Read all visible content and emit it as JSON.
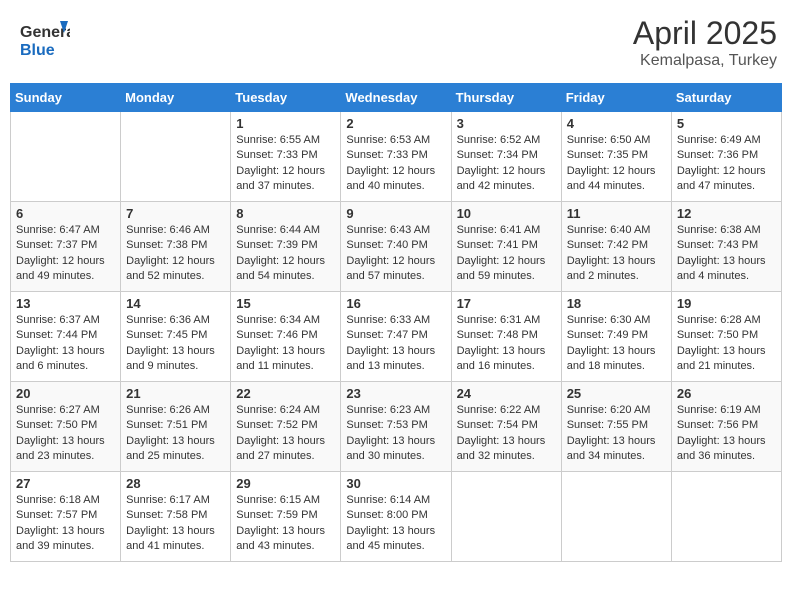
{
  "header": {
    "logo_general": "General",
    "logo_blue": "Blue",
    "title": "April 2025",
    "subtitle": "Kemalpasa, Turkey"
  },
  "days_of_week": [
    "Sunday",
    "Monday",
    "Tuesday",
    "Wednesday",
    "Thursday",
    "Friday",
    "Saturday"
  ],
  "weeks": [
    [
      {
        "day": "",
        "content": ""
      },
      {
        "day": "",
        "content": ""
      },
      {
        "day": "1",
        "content": "Sunrise: 6:55 AM\nSunset: 7:33 PM\nDaylight: 12 hours and 37 minutes."
      },
      {
        "day": "2",
        "content": "Sunrise: 6:53 AM\nSunset: 7:33 PM\nDaylight: 12 hours and 40 minutes."
      },
      {
        "day": "3",
        "content": "Sunrise: 6:52 AM\nSunset: 7:34 PM\nDaylight: 12 hours and 42 minutes."
      },
      {
        "day": "4",
        "content": "Sunrise: 6:50 AM\nSunset: 7:35 PM\nDaylight: 12 hours and 44 minutes."
      },
      {
        "day": "5",
        "content": "Sunrise: 6:49 AM\nSunset: 7:36 PM\nDaylight: 12 hours and 47 minutes."
      }
    ],
    [
      {
        "day": "6",
        "content": "Sunrise: 6:47 AM\nSunset: 7:37 PM\nDaylight: 12 hours and 49 minutes."
      },
      {
        "day": "7",
        "content": "Sunrise: 6:46 AM\nSunset: 7:38 PM\nDaylight: 12 hours and 52 minutes."
      },
      {
        "day": "8",
        "content": "Sunrise: 6:44 AM\nSunset: 7:39 PM\nDaylight: 12 hours and 54 minutes."
      },
      {
        "day": "9",
        "content": "Sunrise: 6:43 AM\nSunset: 7:40 PM\nDaylight: 12 hours and 57 minutes."
      },
      {
        "day": "10",
        "content": "Sunrise: 6:41 AM\nSunset: 7:41 PM\nDaylight: 12 hours and 59 minutes."
      },
      {
        "day": "11",
        "content": "Sunrise: 6:40 AM\nSunset: 7:42 PM\nDaylight: 13 hours and 2 minutes."
      },
      {
        "day": "12",
        "content": "Sunrise: 6:38 AM\nSunset: 7:43 PM\nDaylight: 13 hours and 4 minutes."
      }
    ],
    [
      {
        "day": "13",
        "content": "Sunrise: 6:37 AM\nSunset: 7:44 PM\nDaylight: 13 hours and 6 minutes."
      },
      {
        "day": "14",
        "content": "Sunrise: 6:36 AM\nSunset: 7:45 PM\nDaylight: 13 hours and 9 minutes."
      },
      {
        "day": "15",
        "content": "Sunrise: 6:34 AM\nSunset: 7:46 PM\nDaylight: 13 hours and 11 minutes."
      },
      {
        "day": "16",
        "content": "Sunrise: 6:33 AM\nSunset: 7:47 PM\nDaylight: 13 hours and 13 minutes."
      },
      {
        "day": "17",
        "content": "Sunrise: 6:31 AM\nSunset: 7:48 PM\nDaylight: 13 hours and 16 minutes."
      },
      {
        "day": "18",
        "content": "Sunrise: 6:30 AM\nSunset: 7:49 PM\nDaylight: 13 hours and 18 minutes."
      },
      {
        "day": "19",
        "content": "Sunrise: 6:28 AM\nSunset: 7:50 PM\nDaylight: 13 hours and 21 minutes."
      }
    ],
    [
      {
        "day": "20",
        "content": "Sunrise: 6:27 AM\nSunset: 7:50 PM\nDaylight: 13 hours and 23 minutes."
      },
      {
        "day": "21",
        "content": "Sunrise: 6:26 AM\nSunset: 7:51 PM\nDaylight: 13 hours and 25 minutes."
      },
      {
        "day": "22",
        "content": "Sunrise: 6:24 AM\nSunset: 7:52 PM\nDaylight: 13 hours and 27 minutes."
      },
      {
        "day": "23",
        "content": "Sunrise: 6:23 AM\nSunset: 7:53 PM\nDaylight: 13 hours and 30 minutes."
      },
      {
        "day": "24",
        "content": "Sunrise: 6:22 AM\nSunset: 7:54 PM\nDaylight: 13 hours and 32 minutes."
      },
      {
        "day": "25",
        "content": "Sunrise: 6:20 AM\nSunset: 7:55 PM\nDaylight: 13 hours and 34 minutes."
      },
      {
        "day": "26",
        "content": "Sunrise: 6:19 AM\nSunset: 7:56 PM\nDaylight: 13 hours and 36 minutes."
      }
    ],
    [
      {
        "day": "27",
        "content": "Sunrise: 6:18 AM\nSunset: 7:57 PM\nDaylight: 13 hours and 39 minutes."
      },
      {
        "day": "28",
        "content": "Sunrise: 6:17 AM\nSunset: 7:58 PM\nDaylight: 13 hours and 41 minutes."
      },
      {
        "day": "29",
        "content": "Sunrise: 6:15 AM\nSunset: 7:59 PM\nDaylight: 13 hours and 43 minutes."
      },
      {
        "day": "30",
        "content": "Sunrise: 6:14 AM\nSunset: 8:00 PM\nDaylight: 13 hours and 45 minutes."
      },
      {
        "day": "",
        "content": ""
      },
      {
        "day": "",
        "content": ""
      },
      {
        "day": "",
        "content": ""
      }
    ]
  ]
}
